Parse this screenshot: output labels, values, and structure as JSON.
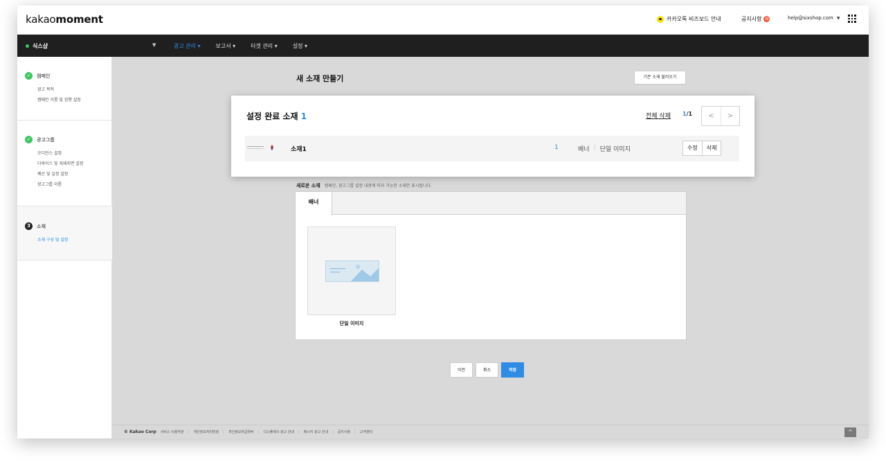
{
  "header": {
    "logo_regular": "kakao",
    "logo_bold": "moment",
    "biz_guide": "카카오톡 비즈보드 안내",
    "notice": "공지사항",
    "notice_badge": "N",
    "account_email": "help@sixshop.com"
  },
  "nav": {
    "account_name": "식스샵",
    "items": [
      {
        "label": "광고 관리 ▾",
        "active": true
      },
      {
        "label": "보고서 ▾"
      },
      {
        "label": "타겟 관리 ▾"
      },
      {
        "label": "설정 ▾"
      }
    ]
  },
  "sidebar": {
    "sections": [
      {
        "title": "캠페인",
        "status": "done",
        "subs": [
          "광고 목적",
          "캠페인 이름 및 집행 설정"
        ]
      },
      {
        "title": "광고그룹",
        "status": "done",
        "subs": [
          "오디언스 설정",
          "디바이스 및 게재지면 설정",
          "예산 및 일정 설정",
          "광고그룹 이름"
        ]
      },
      {
        "title": "소재",
        "status": "current",
        "step": "3",
        "subs": [
          "소재 구성 및 설정"
        ]
      }
    ]
  },
  "main": {
    "title": "새 소재 만들기",
    "load_button": "기존 소재 불러오기"
  },
  "completed": {
    "title": "설정 완료 소재",
    "count": "1",
    "delete_all": "전체 삭제",
    "page_current": "1",
    "page_total": "/1",
    "prev": "<",
    "next": ">",
    "item": {
      "name": "소재1",
      "count": "1",
      "type": "배너",
      "format": "단일 이미지",
      "edit": "수정",
      "delete": "삭제"
    }
  },
  "new_material": {
    "label": "새로운 소재",
    "hint": "캠페인, 광고그룹 설정 내용에 따라 가능한 소재만 표시됩니다.",
    "tab": "배너",
    "card_label": "단일 이미지"
  },
  "actions": {
    "prev": "이전",
    "cancel": "취소",
    "save": "저장"
  },
  "footer": {
    "corp": "© Kakao Corp",
    "links": [
      "서비스 이용약관",
      "개인정보처리방침",
      "개인정보취급위탁",
      "디스플레이 광고 안내",
      "메시지 광고 안내",
      "공지사항",
      "고객센터"
    ],
    "top_button": "^"
  },
  "colors": {
    "accent": "#2f8ce5",
    "nav_bg": "#1f1f1f",
    "check_green": "#3ec861",
    "kakao_yellow": "#fae100"
  }
}
